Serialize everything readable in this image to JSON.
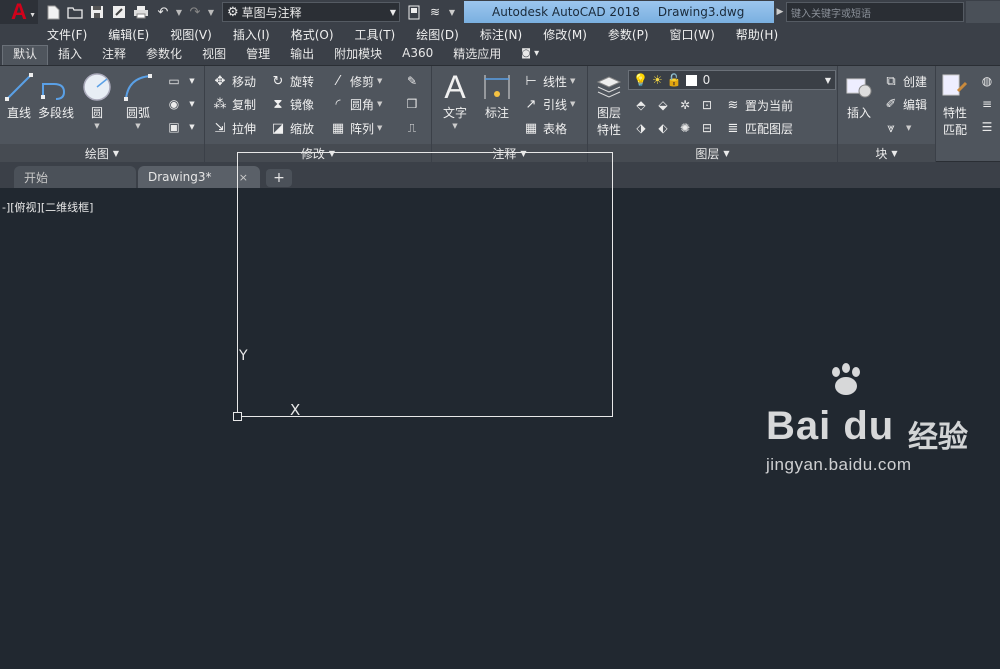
{
  "titlebar": {
    "app_logo": "A",
    "workspace": "草图与注释",
    "app_name": "Autodesk AutoCAD 2018",
    "doc_name": "Drawing3.dwg",
    "search_placeholder": "键入关键字或短语"
  },
  "menu": [
    "文件(F)",
    "编辑(E)",
    "视图(V)",
    "插入(I)",
    "格式(O)",
    "工具(T)",
    "绘图(D)",
    "标注(N)",
    "修改(M)",
    "参数(P)",
    "窗口(W)",
    "帮助(H)"
  ],
  "ribbon_tabs": [
    "默认",
    "插入",
    "注释",
    "参数化",
    "视图",
    "管理",
    "输出",
    "附加模块",
    "A360",
    "精选应用"
  ],
  "panels": {
    "draw": {
      "title": "绘图",
      "line": "直线",
      "polyline": "多段线",
      "circle": "圆",
      "arc": "圆弧"
    },
    "modify": {
      "title": "修改",
      "move": "移动",
      "rotate": "旋转",
      "trim": "修剪",
      "copy": "复制",
      "mirror": "镜像",
      "fillet": "圆角",
      "stretch": "拉伸",
      "scale": "缩放",
      "array": "阵列"
    },
    "annotation": {
      "title": "注释",
      "text": "文字",
      "dimension": "标注",
      "linear": "线性",
      "leader": "引线",
      "table": "表格"
    },
    "layers": {
      "title": "图层",
      "props_line1": "图层",
      "props_line2": "特性",
      "current_layer": "0",
      "set_current": "置为当前",
      "match_layer": "匹配图层"
    },
    "block": {
      "title": "块",
      "insert": "插入",
      "create": "创建",
      "edit": "编辑"
    },
    "properties": {
      "match_line1": "特性",
      "match_line2": "匹配"
    }
  },
  "file_tabs": {
    "start": "开始",
    "drawing": "Drawing3*",
    "close": "×",
    "new": "+"
  },
  "viewport": {
    "label": "-][俯视][二维线框]",
    "ucs_x": "X",
    "ucs_y": "Y"
  },
  "watermark": {
    "brand": "Bai du",
    "cn": "经验",
    "url": "jingyan.baidu.com"
  }
}
